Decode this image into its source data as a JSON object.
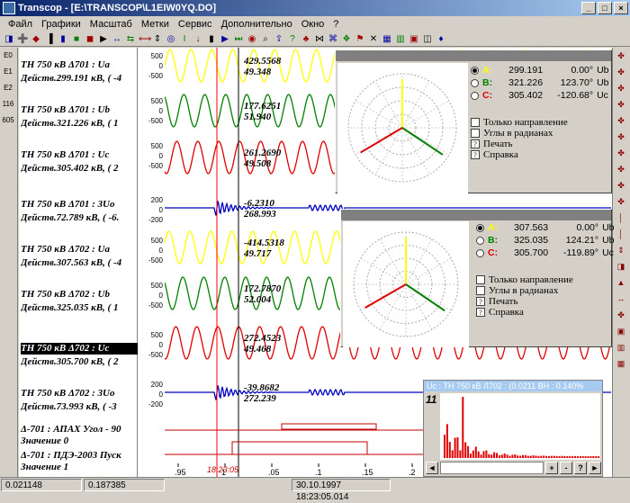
{
  "window": {
    "title": "Transcop - [E:\\TRANSCOP\\L1EIW0YQ.DO]"
  },
  "menu": [
    "Файл",
    "Графики",
    "Масштаб",
    "Метки",
    "Сервис",
    "Дополнительно",
    "Окно",
    "?"
  ],
  "left_tools": [
    "E0",
    "E1",
    "E2",
    "116",
    "605"
  ],
  "channels": [
    {
      "name": "ТН 750 кВ Δ701 : Ua",
      "value": "Действ.299.191 кВ, ( -4"
    },
    {
      "name": "ТН 750 кВ Δ701 : Ub",
      "value": "Действ.321.226 кВ, ( 1"
    },
    {
      "name": "ТН 750 кВ Δ701 : Uc",
      "value": "Действ.305.402 кВ, ( 2"
    },
    {
      "name": "ТН 750 кВ Δ701 : 3Uo",
      "value": "Действ.72.789 кВ, ( -6."
    },
    {
      "name": "ТН 750 кВ Δ702 : Ua",
      "value": "Действ.307.563 кВ, ( -4"
    },
    {
      "name": "ТН 750 кВ Δ702 : Ub",
      "value": "Действ.325.035 кВ, ( 1"
    },
    {
      "name": "ТН 750 кВ Δ702 : Uc",
      "value": "Действ.305.700 кВ, ( 2"
    },
    {
      "name": "ТН 750 кВ Δ702 : 3Uo",
      "value": "Действ.73.993 кВ, ( -3"
    }
  ],
  "digital": [
    {
      "name": "Δ-701 : АПАХ Угол - 90",
      "value": "Значение 0"
    },
    {
      "name": "Δ-701 : ПДЭ-2003 Пуск",
      "value": "Значение 1"
    }
  ],
  "scale_labels": [
    "500",
    "0",
    "-500",
    "200",
    "0",
    "-200"
  ],
  "cursor_values": [
    [
      "429.5568",
      "49.348"
    ],
    [
      "177.6251",
      "51.940"
    ],
    [
      "261.2690",
      "49.508"
    ],
    [
      "-6.2310",
      "268.993"
    ],
    [
      "-414.5318",
      "49.717"
    ],
    [
      "172.7870",
      "52.004"
    ],
    [
      "272.4523",
      "49.468"
    ],
    [
      "-39.8682",
      "272.239"
    ]
  ],
  "time_axis": {
    "ticks": [
      ".95",
      "1",
      ".05",
      ".1",
      ".15",
      ".2"
    ],
    "marker": "18:23:05"
  },
  "phasor1": {
    "rows": [
      {
        "label": "A:",
        "value": "299.191",
        "angle": "0.00°",
        "unit": "Ub"
      },
      {
        "label": "B:",
        "value": "321.226",
        "angle": "123.70°",
        "unit": "Ub"
      },
      {
        "label": "C:",
        "value": "305.402",
        "angle": "-120.68°",
        "unit": "Uc"
      }
    ],
    "options": [
      "Только направление",
      "Углы в радианах",
      "Печать",
      "Справка"
    ]
  },
  "phasor2": {
    "rows": [
      {
        "label": "A:",
        "value": "307.563",
        "angle": "0.00°",
        "unit": "Ub"
      },
      {
        "label": "B:",
        "value": "325.035",
        "angle": "124.21°",
        "unit": "Ub"
      },
      {
        "label": "C:",
        "value": "305.700",
        "angle": "-119.89°",
        "unit": "Uc"
      }
    ],
    "options": [
      "Только направление",
      "Углы в радианах",
      "Печать",
      "Справка"
    ]
  },
  "histogram": {
    "title": "Uc : ТН 750 кВ Л702 : (0.0211 ВН : 0.140%",
    "count": "11"
  },
  "status": [
    "0.021148",
    "0.187385",
    "30.10.1997 18:23:05.014"
  ],
  "colors": {
    "phaseA": "#ffff00",
    "phaseB": "#008000",
    "phaseC": "#e00000",
    "zero": "#0000c0"
  }
}
